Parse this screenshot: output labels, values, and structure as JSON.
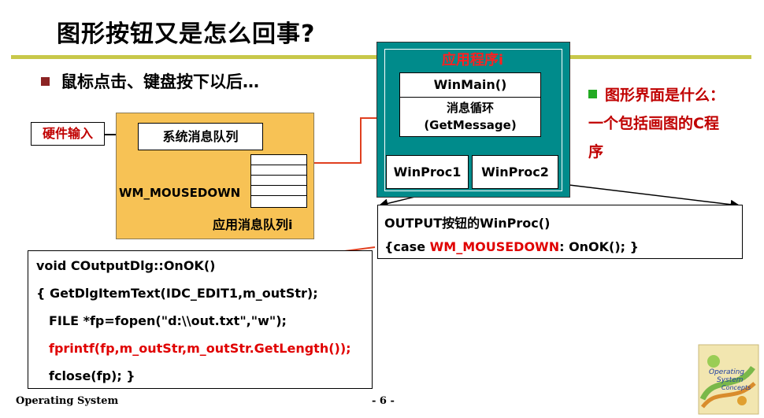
{
  "slide": {
    "title": "图形按钮又是怎么回事?",
    "bullet_main": "鼠标点击、键盘按下以后…",
    "page_number": "- 6 -",
    "footer_left": "Operating System"
  },
  "system_queue": {
    "hardware_input": "硬件输入",
    "system_queue_label": "系统消息队列",
    "message": "WM_MOUSEDOWN",
    "app_queue_label": "应用消息队列i"
  },
  "app": {
    "title": "应用程序i",
    "winmain": "WinMain()",
    "loop_line1": "消息循环",
    "loop_line2": "(GetMessage)",
    "winproc1": "WinProc1",
    "winproc2": "WinProc2"
  },
  "side_note": {
    "text": "图形界面是什么：一个包括画图的C程序"
  },
  "output_proc": {
    "line1": "OUTPUT按钮的WinProc()",
    "line2_pre": "{case ",
    "line2_red": "WM_MOUSEDOWN",
    "line2_post": ": OnOK(); }"
  },
  "code": {
    "line1": "void COutputDlg::OnOK()",
    "line2": "{  GetDlgItemText(IDC_EDIT1,m_outStr);",
    "line3": "FILE *fp=fopen(\"d:\\\\out.txt\",\"w\");",
    "line4": "fprintf(fp,m_outStr,m_outStr.GetLength());",
    "line5": "fclose(fp); }"
  },
  "logo": {
    "line1": "Operating",
    "line2": "System",
    "line3": "Concepts"
  },
  "colors": {
    "accent_red": "#e00000",
    "rule": "#c8c84a",
    "queue_bg": "#f7c255",
    "app_bg": "#008b8b"
  }
}
